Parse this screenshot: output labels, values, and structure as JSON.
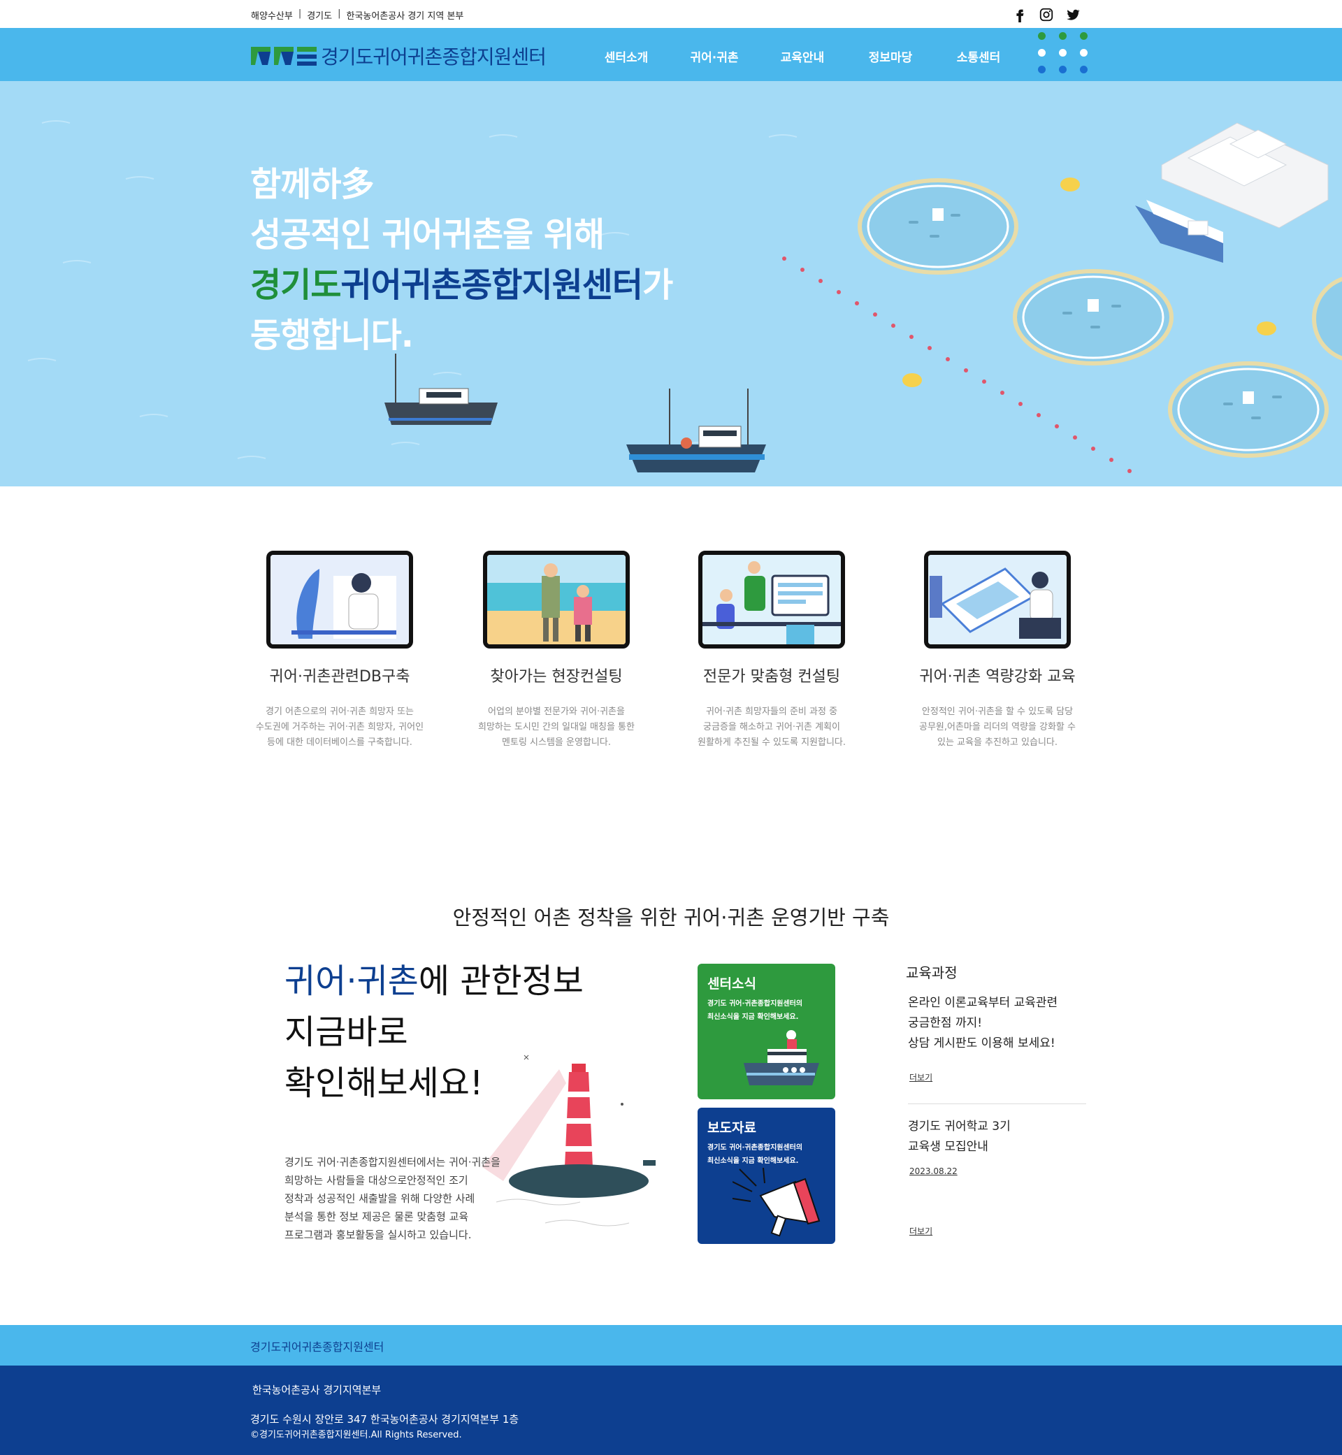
{
  "topbar": {
    "links": [
      "해양수산부",
      "경기도",
      "한국농어촌공사 경기 지역 본부"
    ],
    "social": [
      "facebook-icon",
      "instagram-icon",
      "twitter-icon"
    ]
  },
  "header": {
    "logo_text": "경기도귀어귀촌종합지원센터",
    "menu": [
      "센터소개",
      "귀어·귀촌",
      "교육안내",
      "정보마당",
      "소통센터"
    ]
  },
  "hero": {
    "line1": "함께하多",
    "line2": "성공적인 귀어귀촌을 위해",
    "line3_green": "경기도",
    "line3_blue": "귀어귀촌종합지원센터",
    "line3_end": "가",
    "line4": "동행합니다."
  },
  "services": [
    {
      "title": "귀어·귀촌관련DB구축",
      "desc": [
        "경기 어촌으로의 귀어·귀촌 희망자 또는",
        "수도권에 거주하는 귀어·귀촌 희망자, 귀어인",
        "등에 대한 데이터베이스를 구축합니다."
      ]
    },
    {
      "title": "찾아가는 현장컨설팅",
      "desc": [
        "어업의 분야별 전문가와 귀어·귀촌을",
        "희망하는 도시민 간의 일대일 매칭을 통한",
        "멘토링 시스템을 운영합니다."
      ]
    },
    {
      "title": "전문가 맞춤형 컨설팅",
      "desc": [
        "귀어·귀촌 희망자들의 준비 과정 중",
        "궁금증을 해소하고 귀어·귀촌 계획이",
        "원활하게 추진될 수 있도록 지원합니다."
      ]
    },
    {
      "title": "귀어·귀촌 역량강화 교육",
      "desc": [
        "안정적인 귀어·귀촌을 할 수 있도록 담당",
        "공무원,어촌마을 리더의 역량을 강화할 수",
        "있는 교육을 추진하고 있습니다."
      ]
    }
  ],
  "section2": {
    "title": "안정적인 어촌 정착을 위한 귀어·귀촌 운영기반 구축",
    "head_blue": "귀어·귀촌",
    "head_rest": "에 관한정보",
    "head_line2": "지금바로",
    "head_line3": "확인해보세요!",
    "body": [
      "경기도 귀어·귀촌종합지원센터에서는 귀어·귀촌을",
      "희망하는 사람들을 대상으로안정적인 조기",
      "정착과 성공적인 새출발을 위해 다양한 사례",
      "분석을 통한 정보 제공은 물론 맞춤형 교육",
      "프로그램과 홍보활동을 실시하고 있습니다."
    ],
    "cards": [
      {
        "title": "센터소식",
        "desc": [
          "경기도 귀어·귀촌종합지원센터의",
          "최신소식을 지금 확인해보세요."
        ],
        "color": "#2e9a3e"
      },
      {
        "title": "보도자료",
        "desc": [
          "경기도 귀어·귀촌종합지원센터의",
          "최신소식을 지금 확인해보세요."
        ],
        "color": "#0d3f90"
      }
    ],
    "edu": {
      "title": "교육과정",
      "item1": [
        "온라인 이론교육부터 교육관련",
        "궁금한점 까지!",
        "상담 게시판도 이용해 보세요!"
      ],
      "more1": "더보기",
      "item2": [
        "경기도 귀어학교 3기",
        "교육생 모집안내"
      ],
      "date": "2023.08.22",
      "more2": "더보기"
    }
  },
  "footer": {
    "name": "경기도귀어귀촌종합지원센터",
    "org": "한국농어촌공사 경기지역본부",
    "address": "경기도 수원시 장안로 347 한국농어촌공사 경기지역본부 1층",
    "copyright": "©경기도귀어귀촌종합지원센터.All Rights Reserved."
  },
  "colors": {
    "nav": "#4ab7ec",
    "hero": "#a3daf6",
    "navy": "#0d3f90",
    "green": "#2e9a3e"
  }
}
